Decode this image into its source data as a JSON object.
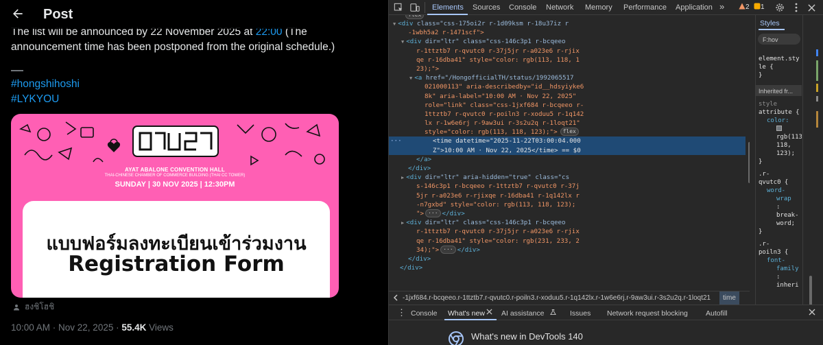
{
  "post": {
    "header_title": "Post",
    "text_line1_prefix": "The list will be announced by 22 November 2025 at ",
    "text_line1_time": "22:00",
    "text_line1_suffix": " (The",
    "text_line2": "announcement time has been postponed from the original schedule.)",
    "hashtags": [
      "#hongshihoshi",
      "#LYKYOU"
    ],
    "media": {
      "venue": "AYAT ABALONE CONVENTION HALL",
      "venue_sub": "THAI-CHINESE CHAMBER OF COMMERCE BUILDING (THAI CC TOWER)",
      "date_line": "SUNDAY | 30 NOV 2025 | 12:30PM",
      "form_title_thai": "แบบฟอร์มลงทะเบียนเข้าร่วมงาน",
      "form_title_en": "Registration Form",
      "credit": "ฮงชิโฮชิ"
    },
    "meta": {
      "timestamp": "10:00 AM · Nov 22, 2025 · ",
      "views_count": "55.4K",
      "views_label": " Views"
    }
  },
  "devtools": {
    "top_tabs": [
      "Elements",
      "Sources",
      "Console",
      "Network",
      "Memory",
      "Performance",
      "Application"
    ],
    "more_tabs": "»",
    "warning_count": "2",
    "error_count": "1",
    "code_lines": [
      {
        "type": "flex_badge_top",
        "badge": "flex"
      },
      {
        "type": "tag_open",
        "indent": 0,
        "arrow": "▼",
        "tag": "div",
        "attrs_text": " class=\"css-175oi2r r-1d09ksm r-18u37iz r",
        "rest": ""
      },
      {
        "type": "cont",
        "indent": 1,
        "text": "-1wbh5a2 r-1471scf\">"
      },
      {
        "type": "tag_open",
        "indent": 1,
        "arrow": "▼",
        "tag": "div",
        "attrs_text": " dir=\"ltr\" class=\"css-146c3p1 r-bcqeeo",
        "rest": ""
      },
      {
        "type": "cont",
        "indent": 2,
        "text": "r-1ttztb7 r-qvutc0 r-37j5jr r-a023e6 r-rjix"
      },
      {
        "type": "cont",
        "indent": 2,
        "text": "qe r-16dba41\" style=\"color: rgb(113, 118, 1"
      },
      {
        "type": "cont",
        "indent": 2,
        "text": "23);\">"
      },
      {
        "type": "tag_open",
        "indent": 2,
        "arrow": "▼",
        "tag": "a",
        "attrs_text": " href=\"/HongofficialTH/status/1992065517",
        "rest": ""
      },
      {
        "type": "cont",
        "indent": 3,
        "text": "021000113\" aria-describedby=\"id__hdsyiyke6"
      },
      {
        "type": "cont",
        "indent": 3,
        "text": "8k\" aria-label=\"10:00 AM · Nov 22, 2025\""
      },
      {
        "type": "cont",
        "indent": 3,
        "text": "role=\"link\" class=\"css-1jxf684 r-bcqeeo r-"
      },
      {
        "type": "cont",
        "indent": 3,
        "text": "1ttztb7 r-qvutc0 r-poiln3 r-xoduu5 r-1q142"
      },
      {
        "type": "cont",
        "indent": 3,
        "text": "lx r-1w6e6rj r-9aw3ui r-3s2u2q r-1loqt21\""
      },
      {
        "type": "cont_badge",
        "indent": 3,
        "text": "style=\"color: rgb(113, 118, 123);\">",
        "badge": "flex"
      },
      {
        "type": "selected",
        "indent": 3,
        "text": "<time datetime=\"2025-11-22T03:00:04.000"
      },
      {
        "type": "selected",
        "indent": 3,
        "text": "Z\">10:00 AM · Nov 22, 2025</time> == $0"
      },
      {
        "type": "close",
        "indent": 2,
        "text": "</a>"
      },
      {
        "type": "close",
        "indent": 1,
        "text": "</div>"
      },
      {
        "type": "tag_open",
        "indent": 1,
        "arrow": "▶",
        "tag": "div",
        "attrs_text": " dir=\"ltr\" aria-hidden=\"true\" class=\"cs",
        "rest": ""
      },
      {
        "type": "cont",
        "indent": 2,
        "text": "s-146c3p1 r-bcqeeo r-1ttztb7 r-qvutc0 r-37j"
      },
      {
        "type": "cont",
        "indent": 2,
        "text": "5jr r-a023e6 r-rjixqe r-16dba41 r-1q142lx r"
      },
      {
        "type": "cont",
        "indent": 2,
        "text": "-n7gxbd\" style=\"color: rgb(113, 118, 123);"
      },
      {
        "type": "cont_ellipsis",
        "indent": 2,
        "text": "\">",
        "after": "</div>"
      },
      {
        "type": "tag_open",
        "indent": 1,
        "arrow": "▶",
        "tag": "div",
        "attrs_text": " dir=\"ltr\" class=\"css-146c3p1 r-bcqeeo",
        "rest": ""
      },
      {
        "type": "cont",
        "indent": 2,
        "text": "r-1ttztb7 r-qvutc0 r-37j5jr r-a023e6 r-rjix"
      },
      {
        "type": "cont",
        "indent": 2,
        "text": "qe r-16dba41\" style=\"color: rgb(231, 233, 2"
      },
      {
        "type": "cont_ellipsis",
        "indent": 2,
        "text": "34);\">",
        "after": "</div>"
      },
      {
        "type": "close",
        "indent": 1,
        "text": "</div>"
      },
      {
        "type": "close",
        "indent": 0,
        "text": "</div>"
      }
    ],
    "breadcrumb_text": "-1jxf684.r-bcqeeo.r-1ttztb7.r-qvutc0.r-poiln3.r-xoduu5.r-1q142lx.r-1w6e6rj.r-9aw3ui.r-3s2u2q.r-1loqt21",
    "breadcrumb_current": "time",
    "styles": {
      "tab_label": "Styles",
      "filter_placeholder": "F:hov",
      "element_style_1": "element.sty",
      "element_style_2": "le {",
      "element_style_3": "}",
      "inherited_label": "Inherited fr...",
      "style_attr_1": "style",
      "style_attr_2": "attribute {",
      "color_prop": "color:",
      "color_val_1": "rgb(113,",
      "color_val_2": "118,",
      "color_val_3": "123);",
      "close1": "}",
      "rule2_sel_1": ".r-",
      "rule2_sel_2": "qvutc0 {",
      "rule2_prop_1": "word-",
      "rule2_prop_2": "wrap",
      "rule2_colon": ":",
      "rule2_val_1": "break-",
      "rule2_val_2": "word;",
      "close2": "}",
      "rule3_sel_1": ".r-",
      "rule3_sel_2": "poiln3 {",
      "rule3_prop_1": "font-",
      "rule3_prop_2": "family",
      "rule3_colon": ":",
      "rule3_val": "inheri"
    },
    "drawer_tabs": [
      "Console",
      "What's new",
      "AI assistance",
      "Issues",
      "Network request blocking",
      "Autofill"
    ],
    "whats_new_title": "What's new in DevTools 140",
    "colors": {
      "accent": "#a8c7fa",
      "selection": "#1f4a75",
      "tag": "#5db0d7",
      "attr_value": "#f29766"
    }
  }
}
